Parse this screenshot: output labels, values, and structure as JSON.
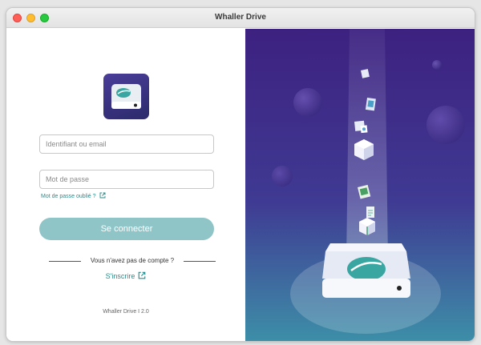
{
  "window": {
    "title": "Whaller Drive"
  },
  "login": {
    "username_placeholder": "Identifiant ou email",
    "password_placeholder": "Mot de passe",
    "forgot_label": "Mot de passe oublié ?",
    "submit_label": "Se connecter",
    "no_account_label": "Vous n'avez pas de compte ?",
    "signup_label": "S'inscrire"
  },
  "footer": {
    "version": "Whaller Drive I 2.0"
  },
  "colors": {
    "accent": "#2a8c8c",
    "button": "#90c5c8",
    "illustration_bg_top": "#3d2180",
    "illustration_bg_bottom": "#3d8fa8"
  },
  "icons": {
    "app": "hard-drive-icon",
    "external_link": "external-link-icon"
  }
}
